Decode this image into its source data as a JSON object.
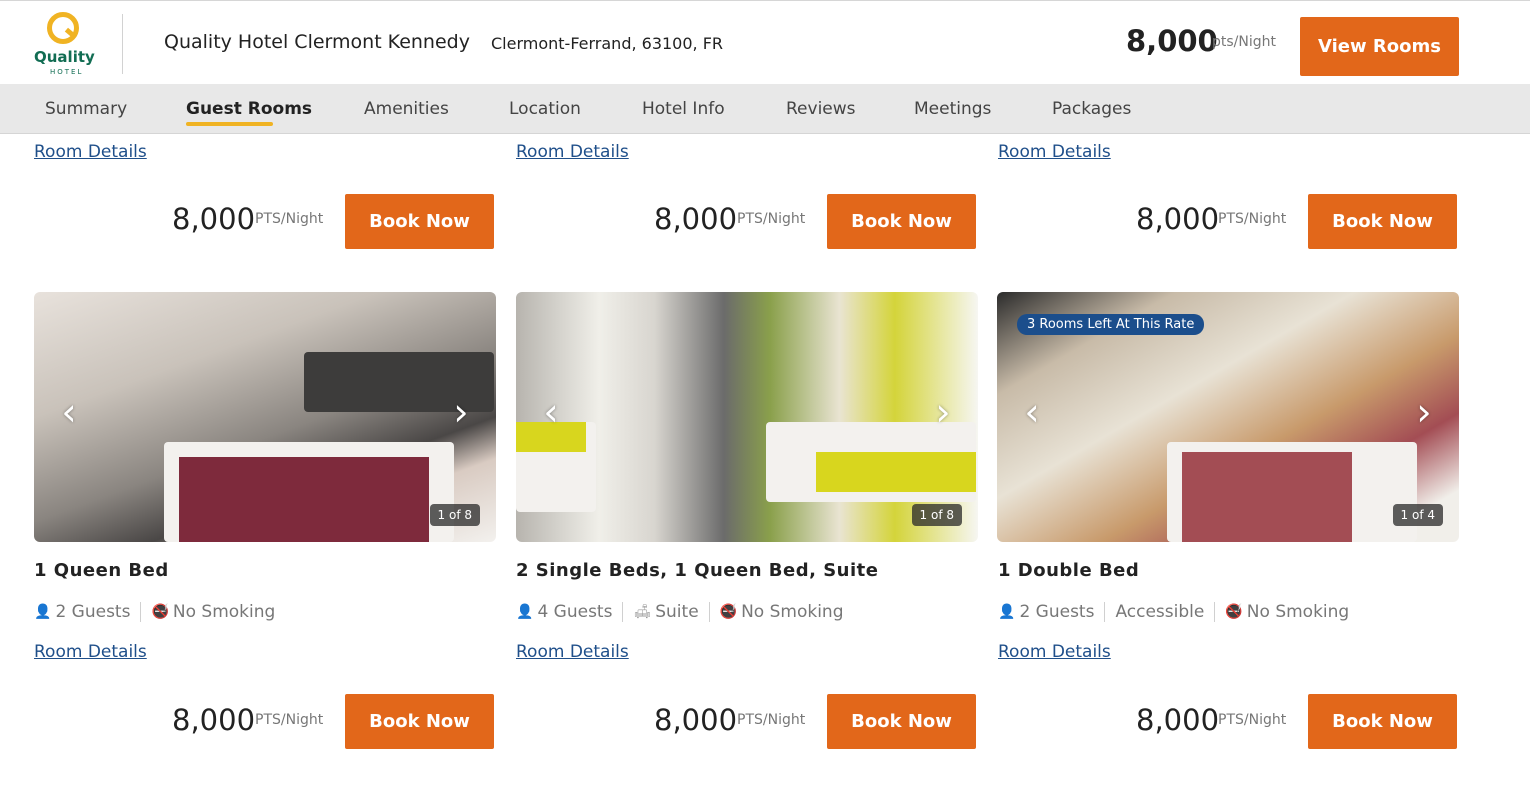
{
  "header": {
    "logo_word": "Quality",
    "logo_sub": "HOTEL",
    "hotel_name": "Quality Hotel Clermont Kennedy",
    "location": "Clermont-Ferrand, 63100, FR",
    "price": "8,000",
    "price_unit": "pts/Night",
    "view_rooms_label": "View Rooms"
  },
  "tabs": [
    {
      "label": "Summary"
    },
    {
      "label": "Guest Rooms",
      "active": true
    },
    {
      "label": "Amenities"
    },
    {
      "label": "Location"
    },
    {
      "label": "Hotel Info"
    },
    {
      "label": "Reviews"
    },
    {
      "label": "Meetings"
    },
    {
      "label": "Packages"
    }
  ],
  "top_row": [
    {
      "details_label": "Room Details",
      "price": "8,000",
      "unit": "PTS/Night",
      "book_label": "Book Now"
    },
    {
      "details_label": "Room Details",
      "price": "8,000",
      "unit": "PTS/Night",
      "book_label": "Book Now"
    },
    {
      "details_label": "Room Details",
      "price": "8,000",
      "unit": "PTS/Night",
      "book_label": "Book Now"
    }
  ],
  "rooms": [
    {
      "title": "1 Queen Bed",
      "counter": "1 of 8",
      "amenities": [
        "2 Guests",
        "No Smoking"
      ],
      "details_label": "Room Details",
      "price": "8,000",
      "unit": "PTS/Night",
      "book_label": "Book Now"
    },
    {
      "title": "2 Single Beds, 1 Queen Bed, Suite",
      "counter": "1 of 8",
      "amenities": [
        "4 Guests",
        "Suite",
        "No Smoking"
      ],
      "details_label": "Room Details",
      "price": "8,000",
      "unit": "PTS/Night",
      "book_label": "Book Now"
    },
    {
      "title": "1 Double Bed",
      "counter": "1 of 4",
      "badge": "3 Rooms Left At This Rate",
      "amenities": [
        "2 Guests",
        "Accessible",
        "No Smoking"
      ],
      "details_label": "Room Details",
      "price": "8,000",
      "unit": "PTS/Night",
      "book_label": "Book Now"
    }
  ],
  "colors": {
    "accent_orange": "#e2671a",
    "tab_underline": "#f0b323",
    "link_blue": "#1f4f8a",
    "badge_blue": "#1b4e8c",
    "brand_green": "#126d53"
  }
}
